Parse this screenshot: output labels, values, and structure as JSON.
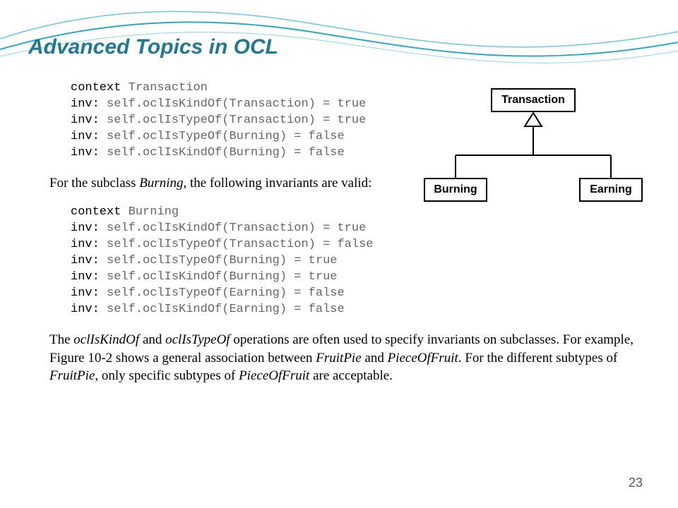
{
  "title": "Advanced Topics in OCL",
  "code_block_1": {
    "context_kw": "context",
    "context_name": "Transaction",
    "lines": [
      "self.oclIsKindOf(Transaction) = true",
      "self.oclIsTypeOf(Transaction) = true",
      "self.oclIsTypeOf(Burning) = false",
      "self.oclIsKindOf(Burning) = false"
    ],
    "inv_kw": "inv:"
  },
  "para_mid_pre": "For the subclass ",
  "para_mid_em": "Burning",
  "para_mid_post": ", the following invariants are valid:",
  "code_block_2": {
    "context_kw": "context",
    "context_name": "Burning",
    "lines": [
      "self.oclIsKindOf(Transaction) = true",
      "self.oclIsTypeOf(Transaction) = false",
      "self.oclIsTypeOf(Burning) = true",
      "self.oclIsKindOf(Burning) = true",
      "self.oclIsTypeOf(Earning) = false",
      "self.oclIsKindOf(Earning) = false"
    ],
    "inv_kw": "inv:"
  },
  "para_bottom": {
    "t1": "The ",
    "e1": "oclIsKindOf",
    "t2": " and ",
    "e2": "oclIsTypeOf",
    "t3": " operations are often used to specify invariants on subclasses. For example, Figure 10-2 shows a general association between ",
    "e3": "FruitPie",
    "t4": " and ",
    "e4": "PieceOfFruit",
    "t5": ". For the different subtypes of ",
    "e5": "FruitPie",
    "t6": ", only specific subtypes of ",
    "e6": "PieceOfFruit",
    "t7": " are acceptable."
  },
  "diagram": {
    "super": "Transaction",
    "sub1": "Burning",
    "sub2": "Earning"
  },
  "page_number": "23"
}
